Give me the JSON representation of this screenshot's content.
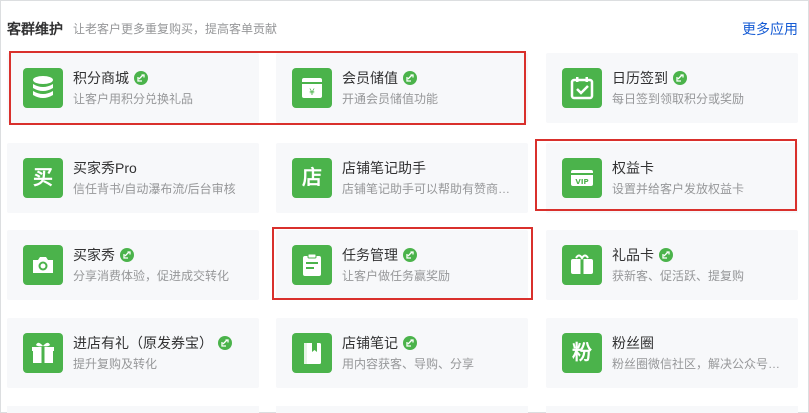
{
  "section": {
    "title": "客群维护",
    "subtitle": "让老客户更多重复购买，提高客单贡献",
    "more_link": "更多应用"
  },
  "accent_color": "#4bb34b",
  "highlight_color": "#d9302c",
  "cards": [
    {
      "name": "积分商城",
      "desc": "让客户用积分兑换礼品",
      "icon": "coin-stack-icon",
      "mini_program": true,
      "highlighted": true
    },
    {
      "name": "会员储值",
      "desc": "开通会员储值功能",
      "icon": "yen-card-icon",
      "mini_program": true,
      "highlighted": true
    },
    {
      "name": "日历签到",
      "desc": "每日签到领取积分或奖励",
      "icon": "calendar-check-icon",
      "mini_program": true,
      "highlighted": false
    },
    {
      "name": "买家秀Pro",
      "desc": "信任背书/自动瀑布流/后台审核",
      "icon": "buy-glyph-icon",
      "icon_text": "买",
      "mini_program": false,
      "highlighted": false
    },
    {
      "name": "店铺笔记助手",
      "desc": "店铺笔记助手可以帮助有赞商家快速创作",
      "icon": "shop-glyph-icon",
      "icon_text": "店",
      "mini_program": false,
      "highlighted": false
    },
    {
      "name": "权益卡",
      "desc": "设置并给客户发放权益卡",
      "icon": "vip-card-icon",
      "icon_text": "VIP",
      "mini_program": false,
      "highlighted": true
    },
    {
      "name": "买家秀",
      "desc": "分享消费体验，促进成交转化",
      "icon": "camera-icon",
      "mini_program": true,
      "highlighted": false
    },
    {
      "name": "任务管理",
      "desc": "让客户做任务赢奖励",
      "icon": "clipboard-icon",
      "mini_program": true,
      "highlighted": true
    },
    {
      "name": "礼品卡",
      "desc": "获新客、促活跃、提复购",
      "icon": "gift-card-icon",
      "mini_program": true,
      "highlighted": false
    },
    {
      "name": "进店有礼（原发券宝）",
      "desc": "提升复购及转化",
      "icon": "gift-box-icon",
      "mini_program": true,
      "highlighted": false
    },
    {
      "name": "店铺笔记",
      "desc": "用内容获客、导购、分享",
      "icon": "notebook-icon",
      "mini_program": true,
      "highlighted": false
    },
    {
      "name": "粉丝圈",
      "desc": "粉丝圈微信社区，解决公众号粉丝互动",
      "icon": "fan-glyph-icon",
      "icon_text": "粉",
      "mini_program": false,
      "highlighted": false
    }
  ]
}
